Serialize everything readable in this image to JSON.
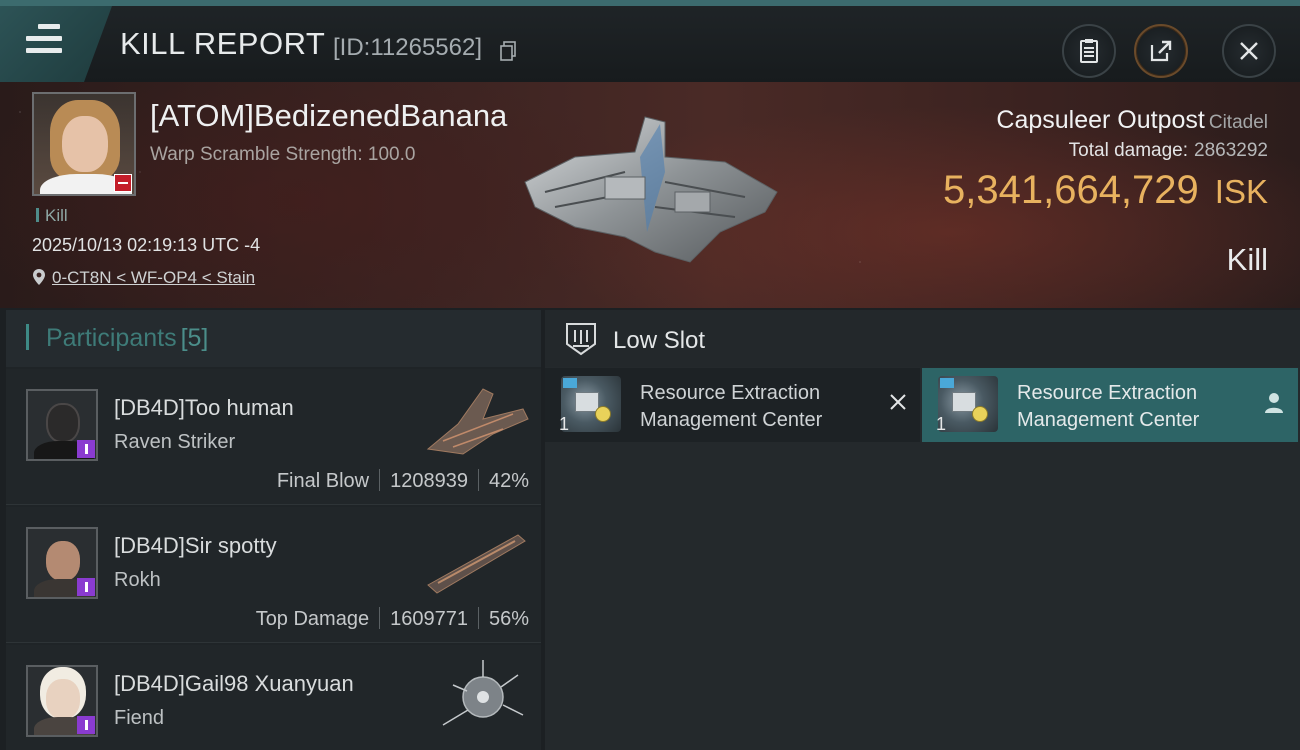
{
  "header": {
    "title": "KILL REPORT",
    "kill_id": "[ID:11265562]"
  },
  "victim": {
    "name": "[ATOM]BedizenedBanana",
    "subtitle": "Warp Scramble Strength: 100.0",
    "tag": "Kill",
    "datetime": "2025/10/13 02:19:13 UTC -4",
    "location": "0-CT8N < WF-OP4 < Stain",
    "target_name": "Capsuleer Outpost",
    "target_type": "Citadel",
    "total_damage_label": "Total damage:",
    "total_damage": "2863292",
    "isk_value": "5,341,664,729",
    "isk_currency": "ISK",
    "result": "Kill"
  },
  "participants": {
    "label": "Participants",
    "count": "[5]",
    "rows": [
      {
        "name": "[DB4D]Too human",
        "ship": "Raven Striker",
        "role": "Final Blow",
        "damage": "1208939",
        "percent": "42%"
      },
      {
        "name": "[DB4D]Sir spotty",
        "ship": "Rokh",
        "role": "Top Damage",
        "damage": "1609771",
        "percent": "56%"
      },
      {
        "name": "[DB4D]Gail98 Xuanyuan",
        "ship": "Fiend"
      }
    ]
  },
  "slots": {
    "title": "Low Slot",
    "modules": [
      {
        "name_line1": "Resource Extraction",
        "name_line2": "Management Center",
        "qty": "1"
      },
      {
        "name_line1": "Resource Extraction",
        "name_line2": "Management Center",
        "qty": "1"
      }
    ]
  },
  "colors": {
    "accent": "#3e8a86",
    "isk": "#e8b25f",
    "highlight_row": "#2d6466"
  }
}
